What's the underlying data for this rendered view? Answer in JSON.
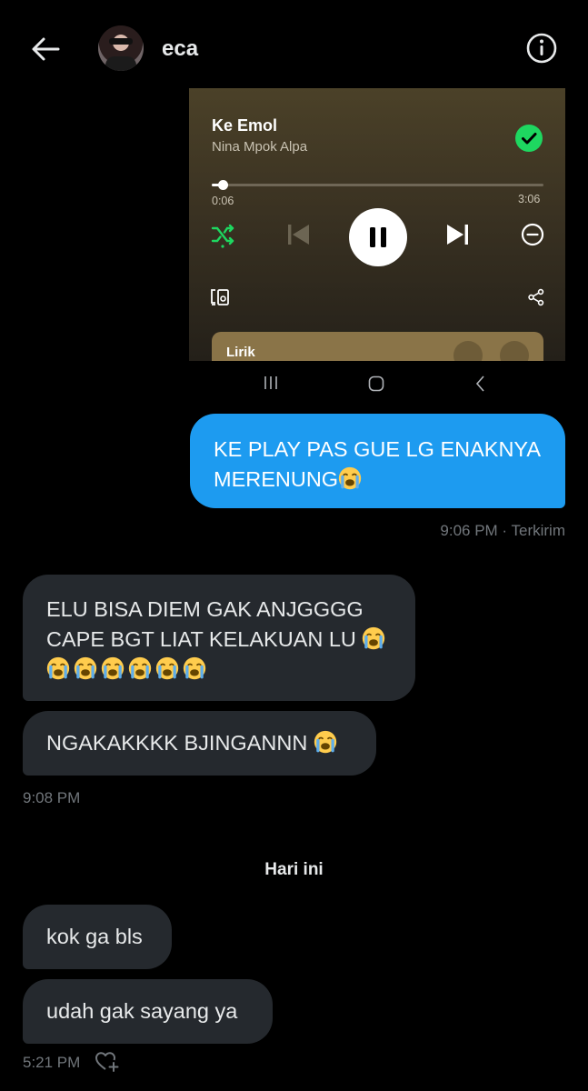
{
  "header": {
    "contact_name": "eca",
    "back_icon": "arrow-left-icon",
    "info_icon": "info-icon"
  },
  "shared_screenshot": {
    "song_title": "Ke Emol",
    "artist": "Nina Mpok Alpa",
    "progress_fraction": 0.033,
    "time_elapsed": "0:06",
    "time_total": "3:06",
    "lyrics_label": "Lirik",
    "accent_color": "#1ed760",
    "controls": [
      "shuffle-icon",
      "previous-icon",
      "pause-icon",
      "next-icon",
      "remove-icon",
      "connect-device-icon",
      "share-icon"
    ],
    "nav_buttons": [
      "recent-apps-icon",
      "home-icon",
      "back-icon"
    ]
  },
  "messages": {
    "sent_1": {
      "text": "KE PLAY PAS GUE LG ENAKNYA MERENUNG",
      "meta": "9:06 PM · Terkirim"
    },
    "recv_1": {
      "text_a": "ELU BISA DIEM GAK ANJGGGG CAPE BGT LIAT KELAKUAN LU"
    },
    "recv_2": {
      "text": "NGAKAKKKK BJINGANNN",
      "time": "9:08 PM"
    },
    "day_separator": "Hari ini",
    "recv_3": {
      "text": "kok ga bls"
    },
    "recv_4": {
      "text": "udah gak sayang ya",
      "time": "5:21 PM"
    }
  },
  "colors": {
    "sent_bubble": "#1d9bf0",
    "received_bubble": "#25292e",
    "background": "#000000"
  }
}
